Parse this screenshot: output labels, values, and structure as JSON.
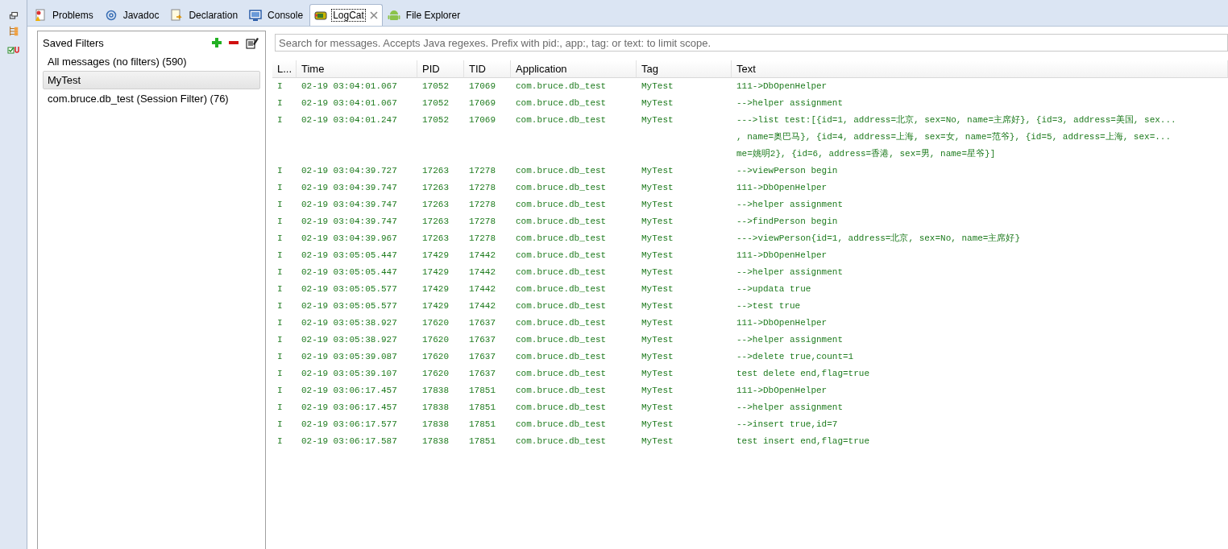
{
  "tabs": [
    {
      "label": "Problems",
      "kind": "problems",
      "selected": false,
      "closable": false
    },
    {
      "label": "Javadoc",
      "kind": "at",
      "selected": false,
      "closable": false
    },
    {
      "label": "Declaration",
      "kind": "declaration",
      "selected": false,
      "closable": false
    },
    {
      "label": "Console",
      "kind": "console",
      "selected": false,
      "closable": false
    },
    {
      "label": "LogCat",
      "kind": "logcat",
      "selected": true,
      "closable": true
    },
    {
      "label": "File Explorer",
      "kind": "android",
      "selected": false,
      "closable": false
    }
  ],
  "filters": {
    "title": "Saved Filters",
    "items": [
      {
        "label": "All messages (no filters) (590)",
        "selected": false
      },
      {
        "label": "MyTest",
        "selected": true
      },
      {
        "label": "com.bruce.db_test (Session Filter) (76)",
        "selected": false
      }
    ]
  },
  "search": {
    "placeholder": "Search for messages. Accepts Java regexes. Prefix with pid:, app:, tag: or text: to limit scope."
  },
  "table": {
    "columns": [
      "L...",
      "Time",
      "PID",
      "TID",
      "Application",
      "Tag",
      "Text"
    ],
    "rows": [
      {
        "level": "I",
        "time": "02-19 03:04:01.067",
        "pid": "17052",
        "tid": "17069",
        "app": "com.bruce.db_test",
        "tag": "MyTest",
        "text": [
          "111->DbOpenHelper"
        ]
      },
      {
        "level": "I",
        "time": "02-19 03:04:01.067",
        "pid": "17052",
        "tid": "17069",
        "app": "com.bruce.db_test",
        "tag": "MyTest",
        "text": [
          "-->helper assignment"
        ]
      },
      {
        "level": "I",
        "time": "02-19 03:04:01.247",
        "pid": "17052",
        "tid": "17069",
        "app": "com.bruce.db_test",
        "tag": "MyTest",
        "text": [
          "--->list test:[{id=1, address=北京, sex=No, name=主席好}, {id=3, address=美国, sex...",
          ", name=奥巴马}, {id=4, address=上海, sex=女, name=范爷}, {id=5, address=上海, sex=...",
          "me=姚明2}, {id=6, address=香港, sex=男, name=星爷}]"
        ]
      },
      {
        "level": "I",
        "time": "02-19 03:04:39.727",
        "pid": "17263",
        "tid": "17278",
        "app": "com.bruce.db_test",
        "tag": "MyTest",
        "text": [
          "-->viewPerson begin"
        ]
      },
      {
        "level": "I",
        "time": "02-19 03:04:39.747",
        "pid": "17263",
        "tid": "17278",
        "app": "com.bruce.db_test",
        "tag": "MyTest",
        "text": [
          "111->DbOpenHelper"
        ]
      },
      {
        "level": "I",
        "time": "02-19 03:04:39.747",
        "pid": "17263",
        "tid": "17278",
        "app": "com.bruce.db_test",
        "tag": "MyTest",
        "text": [
          "-->helper assignment"
        ]
      },
      {
        "level": "I",
        "time": "02-19 03:04:39.747",
        "pid": "17263",
        "tid": "17278",
        "app": "com.bruce.db_test",
        "tag": "MyTest",
        "text": [
          "-->findPerson begin"
        ]
      },
      {
        "level": "I",
        "time": "02-19 03:04:39.967",
        "pid": "17263",
        "tid": "17278",
        "app": "com.bruce.db_test",
        "tag": "MyTest",
        "text": [
          "--->viewPerson{id=1, address=北京, sex=No, name=主席好}"
        ]
      },
      {
        "level": "I",
        "time": "02-19 03:05:05.447",
        "pid": "17429",
        "tid": "17442",
        "app": "com.bruce.db_test",
        "tag": "MyTest",
        "text": [
          "111->DbOpenHelper"
        ]
      },
      {
        "level": "I",
        "time": "02-19 03:05:05.447",
        "pid": "17429",
        "tid": "17442",
        "app": "com.bruce.db_test",
        "tag": "MyTest",
        "text": [
          "-->helper assignment"
        ]
      },
      {
        "level": "I",
        "time": "02-19 03:05:05.577",
        "pid": "17429",
        "tid": "17442",
        "app": "com.bruce.db_test",
        "tag": "MyTest",
        "text": [
          "-->updata true"
        ]
      },
      {
        "level": "I",
        "time": "02-19 03:05:05.577",
        "pid": "17429",
        "tid": "17442",
        "app": "com.bruce.db_test",
        "tag": "MyTest",
        "text": [
          "-->test true"
        ]
      },
      {
        "level": "I",
        "time": "02-19 03:05:38.927",
        "pid": "17620",
        "tid": "17637",
        "app": "com.bruce.db_test",
        "tag": "MyTest",
        "text": [
          "111->DbOpenHelper"
        ]
      },
      {
        "level": "I",
        "time": "02-19 03:05:38.927",
        "pid": "17620",
        "tid": "17637",
        "app": "com.bruce.db_test",
        "tag": "MyTest",
        "text": [
          "-->helper assignment"
        ]
      },
      {
        "level": "I",
        "time": "02-19 03:05:39.087",
        "pid": "17620",
        "tid": "17637",
        "app": "com.bruce.db_test",
        "tag": "MyTest",
        "text": [
          "-->delete true,count=1"
        ]
      },
      {
        "level": "I",
        "time": "02-19 03:05:39.107",
        "pid": "17620",
        "tid": "17637",
        "app": "com.bruce.db_test",
        "tag": "MyTest",
        "text": [
          "test delete end,flag=true"
        ]
      },
      {
        "level": "I",
        "time": "02-19 03:06:17.457",
        "pid": "17838",
        "tid": "17851",
        "app": "com.bruce.db_test",
        "tag": "MyTest",
        "text": [
          "111->DbOpenHelper"
        ]
      },
      {
        "level": "I",
        "time": "02-19 03:06:17.457",
        "pid": "17838",
        "tid": "17851",
        "app": "com.bruce.db_test",
        "tag": "MyTest",
        "text": [
          "-->helper assignment"
        ]
      },
      {
        "level": "I",
        "time": "02-19 03:06:17.577",
        "pid": "17838",
        "tid": "17851",
        "app": "com.bruce.db_test",
        "tag": "MyTest",
        "text": [
          "-->insert true,id=7"
        ]
      },
      {
        "level": "I",
        "time": "02-19 03:06:17.587",
        "pid": "17838",
        "tid": "17851",
        "app": "com.bruce.db_test",
        "tag": "MyTest",
        "text": [
          "test insert end,flag=true"
        ]
      }
    ]
  }
}
